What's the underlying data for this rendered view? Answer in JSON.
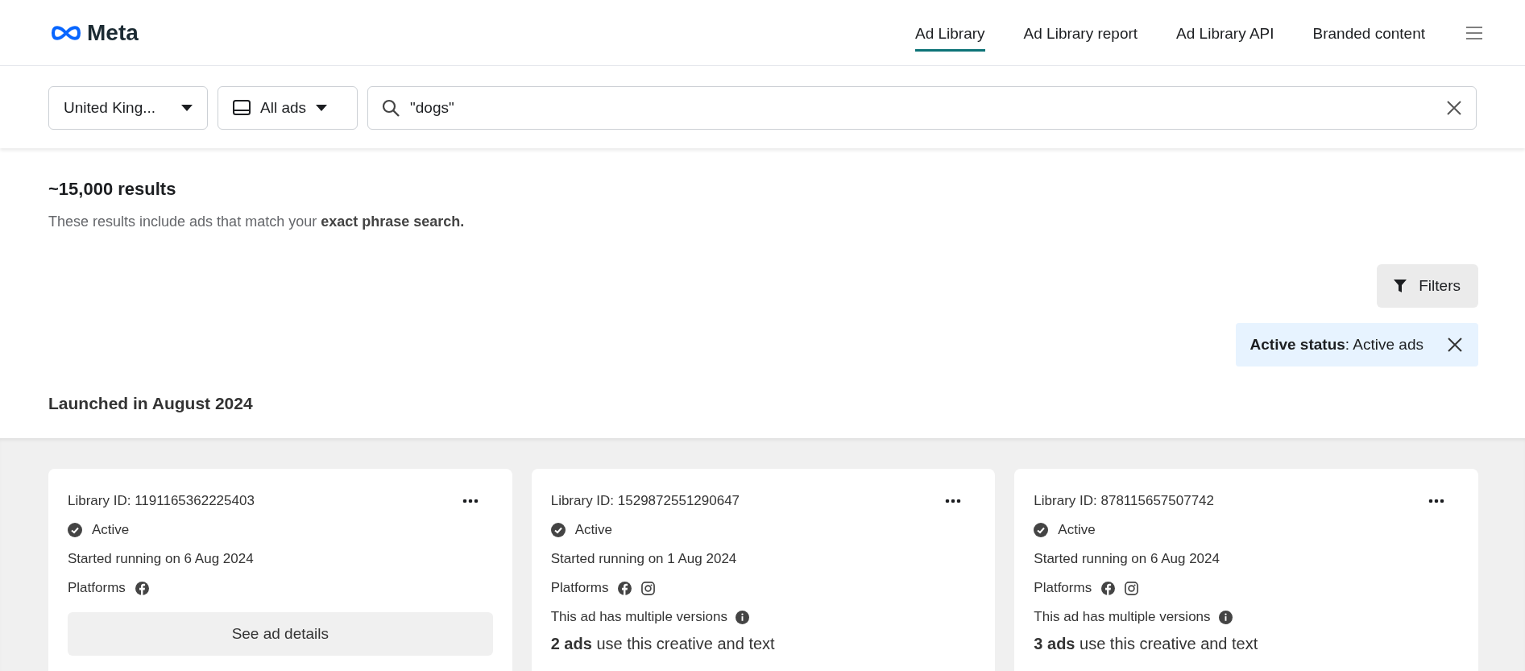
{
  "brand": {
    "name": "Meta"
  },
  "nav": [
    {
      "label": "Ad Library",
      "selected": true
    },
    {
      "label": "Ad Library report",
      "selected": false
    },
    {
      "label": "Ad Library API",
      "selected": false
    },
    {
      "label": "Branded content",
      "selected": false
    }
  ],
  "search_bar": {
    "country": "United King...",
    "ad_type": "All ads",
    "query": "\"dogs\""
  },
  "results": {
    "count": "~15,000 results",
    "description": "These results include ads that match your **exact phrase search.**"
  },
  "filters_button": "Filters",
  "active_filter": {
    "text": "**Active status**: Active ads"
  },
  "section_title": "Launched in August 2024",
  "cards": [
    {
      "library_id": "Library ID: 1191165362225403",
      "status": "Active",
      "started": "Started running on 6 Aug 2024",
      "platforms_label": "Platforms",
      "platforms": [
        {
          "kind": "facebook"
        }
      ],
      "details_button": "See ad details"
    },
    {
      "library_id": "Library ID: 1529872551290647",
      "status": "Active",
      "started": "Started running on 1 Aug 2024",
      "platforms_label": "Platforms",
      "platforms": [
        {
          "kind": "facebook"
        },
        {
          "kind": "instagram"
        }
      ],
      "versions_note": "This ad has multiple versions",
      "creative_count": "**2 ads** use this creative and text"
    },
    {
      "library_id": "Library ID: 878115657507742",
      "status": "Active",
      "started": "Started running on 6 Aug 2024",
      "platforms_label": "Platforms",
      "platforms": [
        {
          "kind": "facebook"
        },
        {
          "kind": "instagram"
        }
      ],
      "versions_note": "This ad has multiple versions",
      "creative_count": "**3 ads** use this creative and text"
    }
  ]
}
